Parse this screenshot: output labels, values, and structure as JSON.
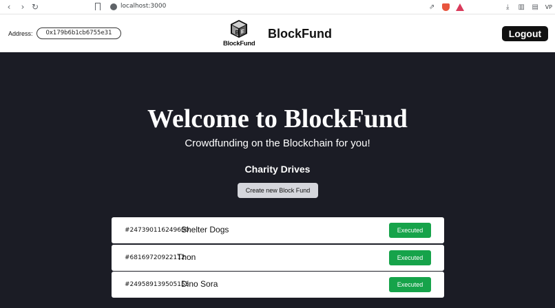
{
  "browser": {
    "url": "localhost:3000",
    "vpn_label": "VP"
  },
  "header": {
    "address_label": "Address:",
    "address_value": "0x179b6b1cb6755e31",
    "logo_text": "BlockFund",
    "brand_title": "BlockFund",
    "logout_label": "Logout"
  },
  "hero": {
    "title": "Welcome to BlockFund",
    "subtitle": "Crowdfunding on the Blockchain for you!"
  },
  "drives": {
    "section_title": "Charity Drives",
    "create_label": "Create new Block Fund",
    "items": [
      {
        "id": "#247390116249600",
        "name": "Shelter Dogs",
        "status": "Executed"
      },
      {
        "id": "#68169720922112",
        "name": "Thon",
        "status": "Executed"
      },
      {
        "id": "#249589139505153",
        "name": "Dino Sora",
        "status": "Executed"
      }
    ]
  },
  "colors": {
    "page_bg": "#1b1c25",
    "status_executed": "#16a34a",
    "logout_bg": "#111111"
  }
}
